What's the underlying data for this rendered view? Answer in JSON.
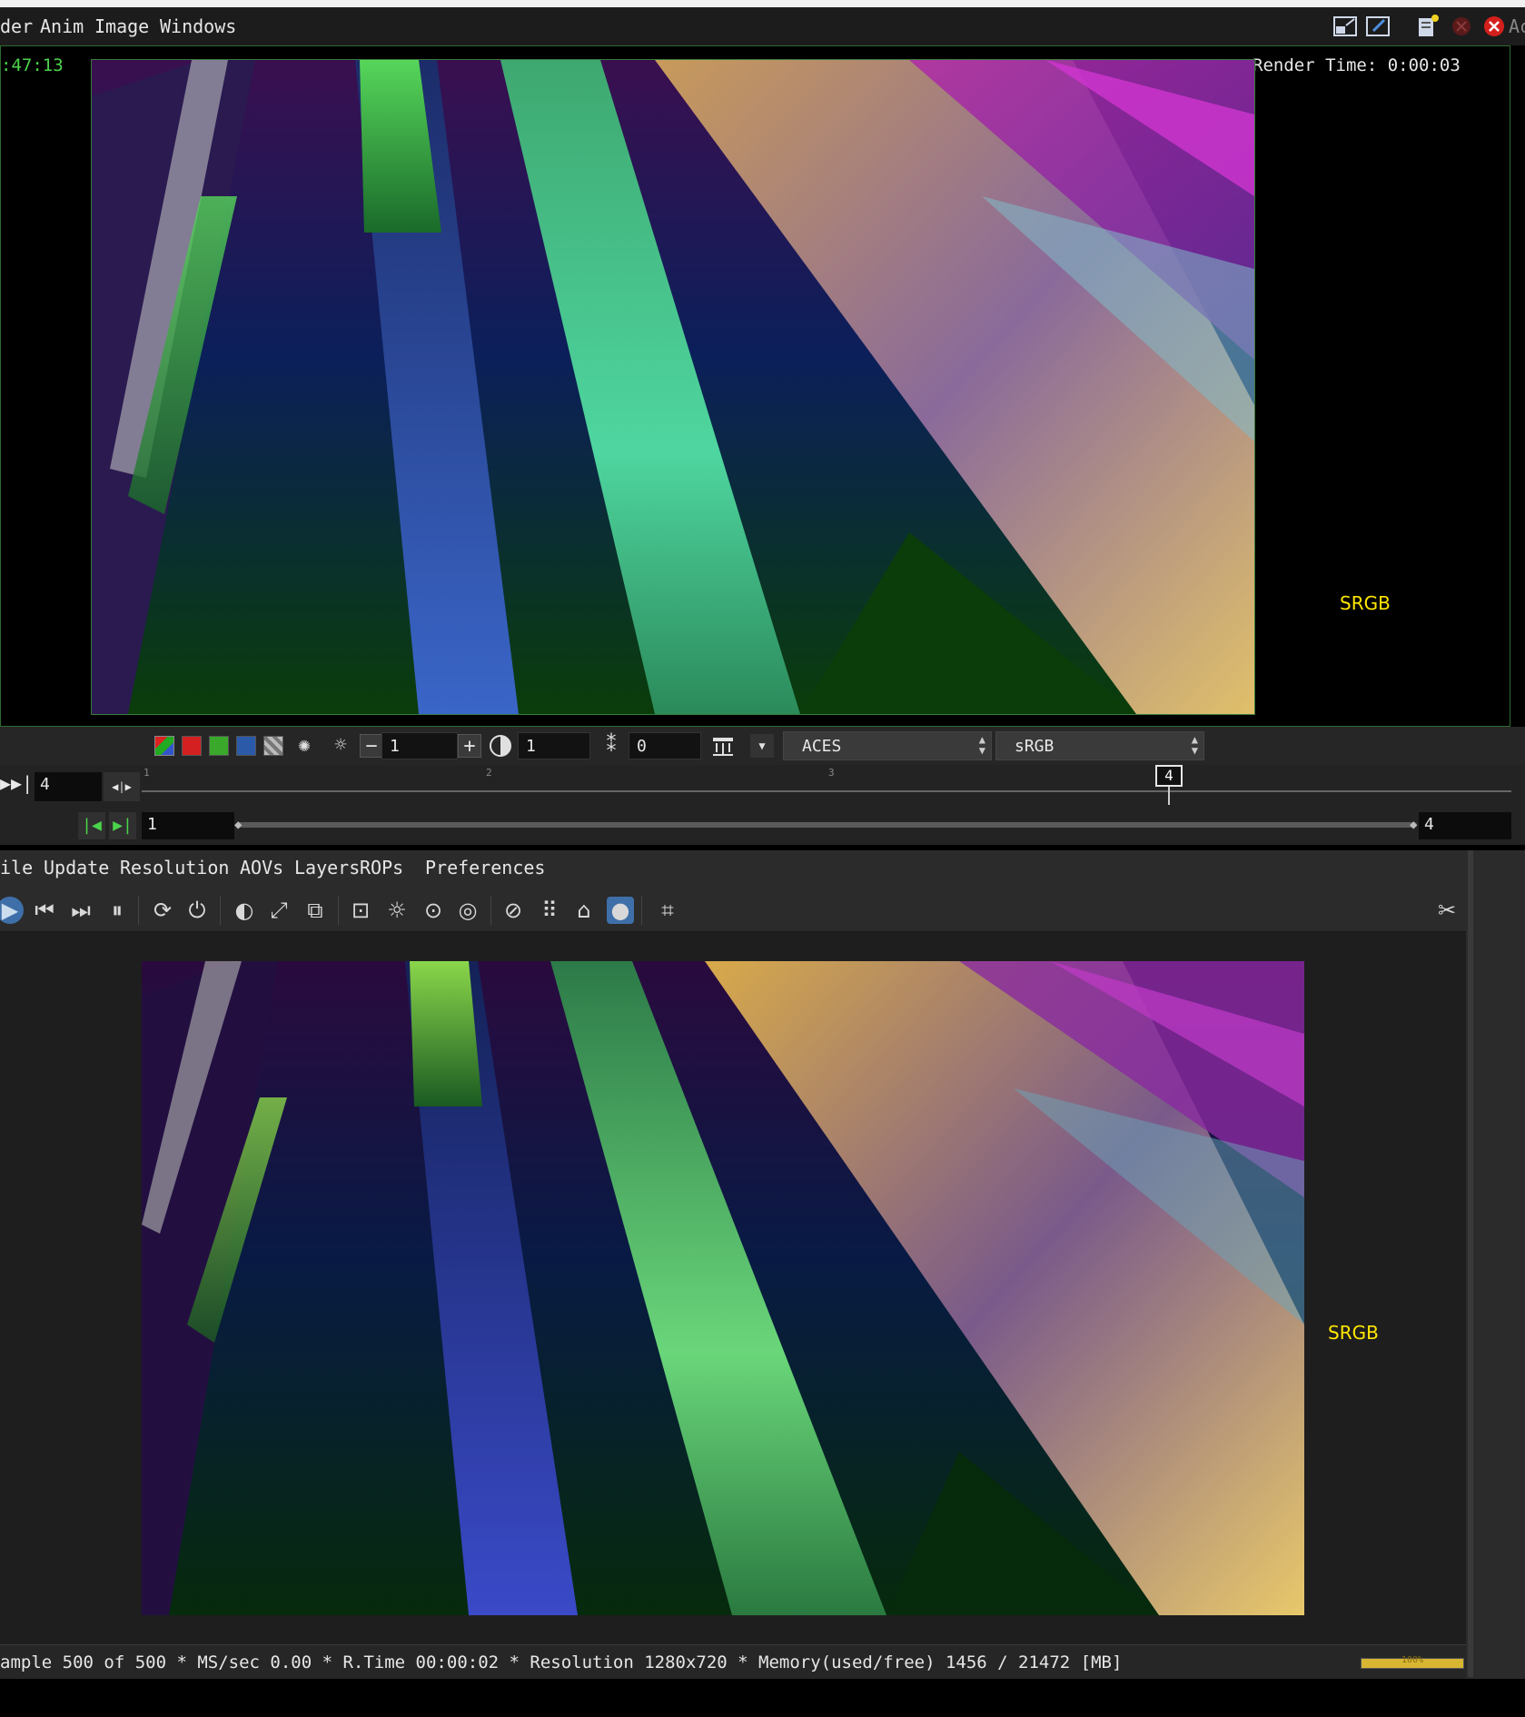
{
  "top_menu": {
    "items": [
      "der",
      "Anim",
      "Image",
      "Windows"
    ],
    "right_cut_text": "Ac"
  },
  "upper_viewer": {
    "time_readout": ":47:13",
    "render_time": "Render Time: 0:00:03",
    "colorspace_label": "SRGB"
  },
  "display_toolbar": {
    "exposure_value": "1",
    "gamma_value": "1",
    "offset_value": "0",
    "view_transform": "ACES",
    "display_space": "sRGB"
  },
  "timeline": {
    "current_frame": "4",
    "ticks": [
      "1",
      "2",
      "3"
    ],
    "playhead_frame": "4",
    "range_start": "1",
    "range_end": "4",
    "playhead_position": 0.75
  },
  "lower_panel": {
    "menu": [
      "ile",
      "Update",
      "Resolution",
      "AOVs",
      "Layers",
      "ROPs",
      "Preferences"
    ],
    "colorspace_label": "SRGB",
    "status": "ample 500 of 500 * MS/sec 0.00 * R.Time 00:00:02 * Resolution 1280x720 * Memory(used/free) 1456 / 21472 [MB]",
    "progress_label": "100%",
    "progress_fraction": 1.0
  },
  "colors": {
    "accent_green": "#4bd34b",
    "srgb_yellow": "#ffe600",
    "progress_gold": "#d8b632"
  }
}
